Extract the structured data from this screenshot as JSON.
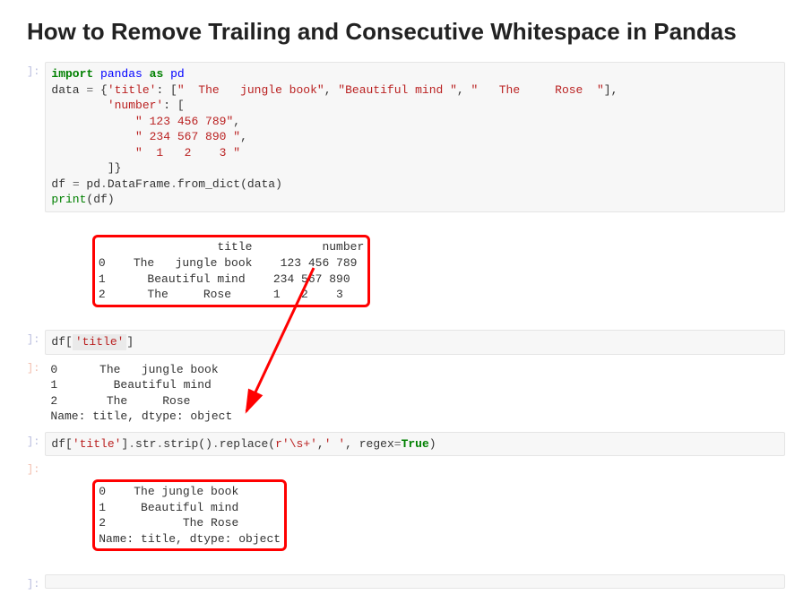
{
  "title": "How to Remove Trailing and Consecutive Whitespace in Pandas",
  "cells": {
    "cell1_code": "import pandas as pd\ndata = {'title': [\"  The   jungle book\", \"Beautiful mind \", \"   The     Rose  \"],\n        'number': [\n            \" 123 456 789\",\n            \" 234 567 890 \",\n            \"  1   2    3 \"\n        ]}\ndf = pd.DataFrame.from_dict(data)\nprint(df)",
    "cell1_output": "                 title          number\n0    The   jungle book    123 456 789\n1      Beautiful mind    234 567 890 \n2      The     Rose      1   2    3 ",
    "cell2_code": "df['title']",
    "cell2_output": "0      The   jungle book\n1        Beautiful mind \n2       The     Rose  \nName: title, dtype: object",
    "cell3_code": "df['title'].str.strip().replace(r'\\s+',' ', regex=True)",
    "cell3_output": "0    The jungle book\n1     Beautiful mind\n2           The Rose\nName: title, dtype: object"
  },
  "prompt_in": "]:",
  "prompt_out": "]:"
}
